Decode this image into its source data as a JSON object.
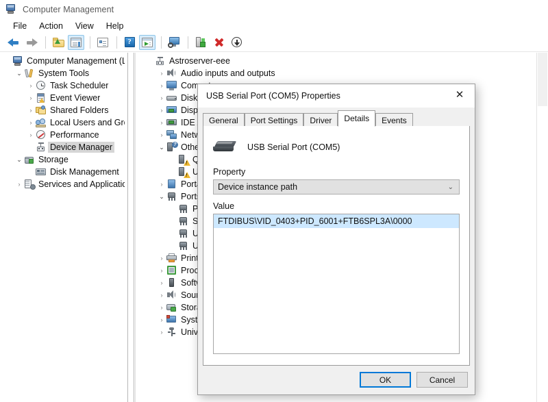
{
  "window": {
    "title": "Computer Management",
    "icon": "computer-management-icon"
  },
  "menubar": {
    "items": [
      {
        "label": "File"
      },
      {
        "label": "Action"
      },
      {
        "label": "View"
      },
      {
        "label": "Help"
      }
    ]
  },
  "toolbar": {
    "buttons": [
      {
        "icon": "back-arrow-icon",
        "name": "back"
      },
      {
        "icon": "forward-arrow-icon",
        "name": "forward"
      },
      {
        "icon": "up-folder-icon",
        "name": "up-one-level"
      },
      {
        "icon": "show-hide-console-tree-icon",
        "name": "show-hide-console-tree",
        "pressed": true
      },
      {
        "icon": "properties-icon",
        "name": "properties"
      },
      {
        "icon": "help-icon",
        "name": "help"
      },
      {
        "icon": "show-hide-action-pane-icon",
        "name": "show-hide-action-pane",
        "pressed": true
      },
      {
        "icon": "scan-computer-icon",
        "name": "scan-for-hardware-changes"
      },
      {
        "icon": "update-driver-icon",
        "name": "update-driver"
      },
      {
        "icon": "uninstall-device-icon",
        "name": "uninstall-device"
      },
      {
        "icon": "install-legacy-icon",
        "name": "install-legacy-hardware"
      }
    ]
  },
  "console_tree": {
    "nodes": [
      {
        "label": "Computer Management (Local",
        "icon": "computer-management-icon",
        "indent": 0,
        "expander": "none",
        "selected": false
      },
      {
        "label": "System Tools",
        "icon": "system-tools-icon",
        "indent": 1,
        "expander": "open",
        "selected": false
      },
      {
        "label": "Task Scheduler",
        "icon": "clock-icon",
        "indent": 2,
        "expander": "closed",
        "selected": false
      },
      {
        "label": "Event Viewer",
        "icon": "event-viewer-icon",
        "indent": 2,
        "expander": "closed",
        "selected": false
      },
      {
        "label": "Shared Folders",
        "icon": "shared-folders-icon",
        "indent": 2,
        "expander": "closed",
        "selected": false
      },
      {
        "label": "Local Users and Groups",
        "icon": "users-groups-icon",
        "indent": 2,
        "expander": "closed",
        "selected": false
      },
      {
        "label": "Performance",
        "icon": "performance-icon",
        "indent": 2,
        "expander": "closed",
        "selected": false
      },
      {
        "label": "Device Manager",
        "icon": "device-manager-icon",
        "indent": 2,
        "expander": "none",
        "selected": true
      },
      {
        "label": "Storage",
        "icon": "storage-icon",
        "indent": 1,
        "expander": "open",
        "selected": false
      },
      {
        "label": "Disk Management",
        "icon": "disk-management-icon",
        "indent": 2,
        "expander": "none",
        "selected": false
      },
      {
        "label": "Services and Applications",
        "icon": "services-applications-icon",
        "indent": 1,
        "expander": "closed",
        "selected": false
      }
    ]
  },
  "device_tree": {
    "nodes": [
      {
        "label": "Astroserver-eee",
        "icon": "computer-node-icon",
        "indent": 0,
        "expander": "none"
      },
      {
        "label": "Audio inputs and outputs",
        "icon": "speaker-icon",
        "indent": 1,
        "expander": "closed"
      },
      {
        "label": "Computer",
        "icon": "monitor-icon",
        "indent": 1,
        "expander": "closed"
      },
      {
        "label": "Disk drives",
        "icon": "hard-disk-icon",
        "indent": 1,
        "expander": "closed"
      },
      {
        "label": "Display adapters",
        "icon": "display-adapter-icon",
        "indent": 1,
        "expander": "closed"
      },
      {
        "label": "IDE ATA/ATAPI controllers",
        "icon": "ide-controller-icon",
        "indent": 1,
        "expander": "closed"
      },
      {
        "label": "Network adapters",
        "icon": "network-adapter-icon",
        "indent": 1,
        "expander": "closed"
      },
      {
        "label": "Other devices",
        "icon": "other-devices-icon",
        "indent": 1,
        "expander": "open"
      },
      {
        "label": "QHY",
        "icon": "unknown-device-icon",
        "indent": 2,
        "expander": "none"
      },
      {
        "label": "Unknown device",
        "icon": "unknown-device-icon",
        "indent": 2,
        "expander": "none"
      },
      {
        "label": "Portable Devices",
        "icon": "portable-device-icon",
        "indent": 1,
        "expander": "closed"
      },
      {
        "label": "Ports (COM & LPT)",
        "icon": "ports-icon",
        "indent": 1,
        "expander": "open"
      },
      {
        "label": "PL",
        "icon": "port-icon",
        "indent": 2,
        "expander": "none"
      },
      {
        "label": "Se",
        "icon": "port-icon",
        "indent": 2,
        "expander": "none"
      },
      {
        "label": "US",
        "icon": "port-icon",
        "indent": 2,
        "expander": "none"
      },
      {
        "label": "US",
        "icon": "port-icon",
        "indent": 2,
        "expander": "none"
      },
      {
        "label": "Print queues",
        "icon": "printer-icon",
        "indent": 1,
        "expander": "closed"
      },
      {
        "label": "Processors",
        "icon": "processor-icon",
        "indent": 1,
        "expander": "closed"
      },
      {
        "label": "Software devices",
        "icon": "software-device-icon",
        "indent": 1,
        "expander": "closed"
      },
      {
        "label": "Sound, video and game controllers",
        "icon": "sound-icon",
        "indent": 1,
        "expander": "closed"
      },
      {
        "label": "Storage controllers",
        "icon": "storage-controller-icon",
        "indent": 1,
        "expander": "closed"
      },
      {
        "label": "System devices",
        "icon": "system-device-icon",
        "indent": 1,
        "expander": "closed"
      },
      {
        "label": "Universal Serial Bus controllers",
        "icon": "usb-controller-icon",
        "indent": 1,
        "expander": "closed"
      }
    ]
  },
  "dialog": {
    "title": "USB Serial Port (COM5) Properties",
    "close_glyph": "✕",
    "tabs": [
      {
        "label": "General",
        "active": false
      },
      {
        "label": "Port Settings",
        "active": false
      },
      {
        "label": "Driver",
        "active": false
      },
      {
        "label": "Details",
        "active": true
      },
      {
        "label": "Events",
        "active": false
      }
    ],
    "device_name": "USB Serial Port (COM5)",
    "device_icon": "usb-serial-port-icon",
    "property_label": "Property",
    "property_selected": "Device instance path",
    "property_chevron": "⌄",
    "value_label": "Value",
    "value_rows": [
      "FTDIBUS\\VID_0403+PID_6001+FTB6SPL3A\\0000"
    ],
    "buttons": {
      "ok": "OK",
      "cancel": "Cancel"
    }
  },
  "colors": {
    "accent": "#0078d7",
    "selection": "#cde8ff",
    "tree_selection": "#d6d6d6",
    "dialog_bg": "#f0f0f0",
    "toolbar_pressed": "#d6ebfb"
  }
}
